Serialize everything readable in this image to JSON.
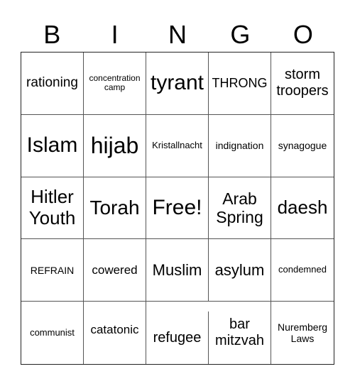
{
  "header": {
    "letters": [
      "B",
      "I",
      "N",
      "G",
      "O"
    ]
  },
  "cells": [
    "rationing",
    "concentration camp",
    "tyrant",
    "THRONG",
    "storm troopers",
    "Islam",
    "hijab",
    "Kristallnacht",
    "indignation",
    "synagogue",
    "Hitler Youth",
    "Torah",
    "Free!",
    "Arab Spring",
    "daesh",
    "REFRAIN",
    "cowered",
    "Muslim",
    "asylum",
    "condemned",
    "communist",
    "catatonic",
    "refugee",
    "bar mitzvah",
    "Nuremberg Laws"
  ]
}
